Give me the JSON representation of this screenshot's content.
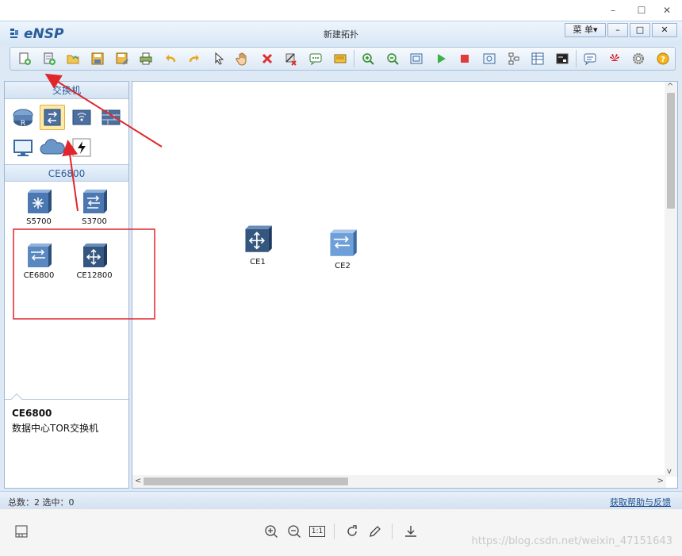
{
  "os_window": {
    "minimize": "–",
    "maximize": "☐",
    "close": "✕"
  },
  "app": {
    "title": "新建拓扑",
    "logo_text": "eNSP",
    "menu_label": "菜 单▾",
    "btn_minimize": "–",
    "btn_maximize": "□",
    "btn_close": "✕"
  },
  "toolbar": {
    "buttons": [
      {
        "name": "new-topology",
        "icon": "new-file-icon"
      },
      {
        "name": "new-lab",
        "icon": "new-page-icon"
      },
      {
        "name": "open",
        "icon": "open-folder-icon"
      },
      {
        "name": "save",
        "icon": "save-icon"
      },
      {
        "name": "save-as",
        "icon": "save-as-icon"
      },
      {
        "name": "print",
        "icon": "print-icon"
      },
      {
        "name": "undo",
        "icon": "undo-icon"
      },
      {
        "name": "redo",
        "icon": "redo-icon"
      },
      {
        "name": "select",
        "icon": "pointer-icon"
      },
      {
        "name": "move",
        "icon": "hand-icon"
      },
      {
        "name": "delete",
        "icon": "delete-icon"
      },
      {
        "name": "delete-links",
        "icon": "delete-link-icon"
      },
      {
        "name": "text",
        "icon": "text-comment-icon"
      },
      {
        "name": "palette",
        "icon": "palette-icon"
      },
      {
        "name": "zoom-in",
        "icon": "zoom-in-icon"
      },
      {
        "name": "zoom-out",
        "icon": "zoom-out-icon"
      },
      {
        "name": "fit",
        "icon": "fit-window-icon"
      },
      {
        "name": "start",
        "icon": "play-icon"
      },
      {
        "name": "stop",
        "icon": "stop-icon"
      },
      {
        "name": "capture",
        "icon": "capture-icon"
      },
      {
        "name": "topology",
        "icon": "topology-icon"
      },
      {
        "name": "grid",
        "icon": "grid-icon"
      },
      {
        "name": "terminal",
        "icon": "terminal-icon"
      },
      {
        "name": "chat",
        "icon": "chat-icon"
      },
      {
        "name": "huawei",
        "icon": "huawei-logo-icon"
      },
      {
        "name": "settings",
        "icon": "gear-icon"
      },
      {
        "name": "help",
        "icon": "help-icon"
      }
    ]
  },
  "left_panel": {
    "category_title": "交换机",
    "categories": [
      {
        "name": "router",
        "icon": "router-icon"
      },
      {
        "name": "switch",
        "icon": "switch-icon",
        "selected": true
      },
      {
        "name": "wireless",
        "icon": "wireless-icon"
      },
      {
        "name": "firewall",
        "icon": "firewall-icon"
      },
      {
        "name": "terminal",
        "icon": "pc-icon"
      },
      {
        "name": "cloud",
        "icon": "cloud-icon"
      },
      {
        "name": "connection",
        "icon": "cable-icon"
      }
    ],
    "subcategory_title": "CE6800",
    "devices": [
      {
        "label": "S5700",
        "icon": "s5700-icon"
      },
      {
        "label": "S3700",
        "icon": "s3700-icon"
      },
      {
        "label": "CE6800",
        "icon": "ce6800-icon"
      },
      {
        "label": "CE12800",
        "icon": "ce12800-icon"
      }
    ],
    "description": {
      "title": "CE6800",
      "text": "数据中心TOR交换机"
    }
  },
  "canvas": {
    "nodes": [
      {
        "label": "CE1",
        "icon": "ce12800-icon"
      },
      {
        "label": "CE2",
        "icon": "ce6800-icon"
      }
    ]
  },
  "statusbar": {
    "left": "总数：2  选中：0",
    "right": "获取帮助与反馈"
  },
  "viewer": {
    "watermark": "https://blog.csdn.net/weixin_47151643",
    "fit_label": "1:1"
  },
  "colors": {
    "accent": "#2c5d99",
    "annotation_red": "#e0262c",
    "selected_bg": "#fde9a8"
  }
}
